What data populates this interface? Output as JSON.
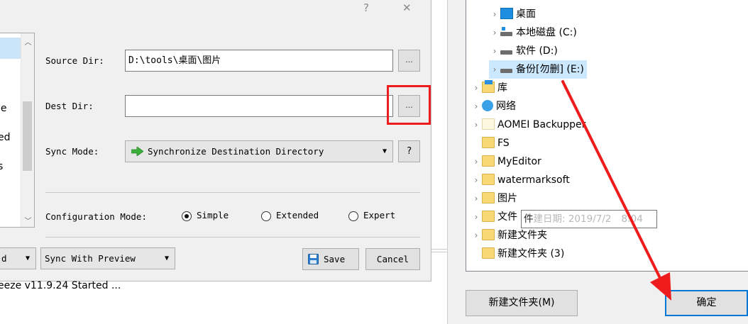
{
  "dialog": {
    "title_buttons": {
      "help": "?",
      "close": "✕"
    },
    "left_list_fragments": [
      "le",
      "ed",
      "s"
    ],
    "source_dir": {
      "label": "Source Dir:",
      "value": "D:\\tools\\桌面\\图片",
      "browse_label": "..."
    },
    "dest_dir": {
      "label": "Dest Dir:",
      "value": "",
      "browse_label": "..."
    },
    "sync_mode": {
      "label": "Sync Mode:",
      "value": "Synchronize Destination Directory",
      "help_label": "?"
    },
    "config_mode": {
      "label": "Configuration Mode:",
      "options": [
        {
          "label": "Simple",
          "selected": true
        },
        {
          "label": "Extended",
          "selected": false
        },
        {
          "label": "Expert",
          "selected": false
        }
      ]
    },
    "bottom": {
      "left_select_fragment": "d",
      "preview_select": "Sync With Preview",
      "save_label": "Save",
      "cancel_label": "Cancel"
    },
    "log_line": "eeze v11.9.24 Started ..."
  },
  "browse": {
    "tree": [
      {
        "label": "桌面",
        "icon": "desktop-icon",
        "indent": 1,
        "expandable": true,
        "selected": false
      },
      {
        "label": "本地磁盘 (C:)",
        "icon": "drive-c-icon",
        "indent": 1,
        "expandable": true,
        "selected": false
      },
      {
        "label": "软件 (D:)",
        "icon": "drive-icon",
        "indent": 1,
        "expandable": true,
        "selected": false
      },
      {
        "label": "备份[勿删] (E:)",
        "icon": "drive-icon",
        "indent": 1,
        "expandable": true,
        "selected": true
      },
      {
        "label": "库",
        "icon": "library-icon",
        "indent": 0,
        "expandable": true,
        "selected": false
      },
      {
        "label": "网络",
        "icon": "network-icon",
        "indent": 0,
        "expandable": true,
        "selected": false
      },
      {
        "label": "AOMEI Backupper",
        "icon": "folder-blank-icon",
        "indent": 0,
        "expandable": true,
        "selected": false
      },
      {
        "label": "FS",
        "icon": "folder-icon",
        "indent": 0,
        "expandable": false,
        "selected": false
      },
      {
        "label": "MyEditor",
        "icon": "folder-icon",
        "indent": 0,
        "expandable": true,
        "selected": false
      },
      {
        "label": "watermarksoft",
        "icon": "folder-icon",
        "indent": 0,
        "expandable": true,
        "selected": false
      },
      {
        "label": "图片",
        "icon": "folder-icon",
        "indent": 0,
        "expandable": true,
        "selected": false
      },
      {
        "label": "文件",
        "icon": "folder-icon",
        "indent": 0,
        "expandable": true,
        "selected": false
      },
      {
        "label": "新建文件夹",
        "icon": "folder-icon",
        "indent": 0,
        "expandable": true,
        "selected": false
      },
      {
        "label": "新建文件夹 (3)",
        "icon": "folder-icon",
        "indent": 0,
        "expandable": false,
        "selected": false
      }
    ],
    "tooltip": {
      "overlap": "件",
      "text": "建日期: 2019/7/2",
      "tail": "8:04"
    },
    "new_folder_label": "新建文件夹(M)",
    "ok_label": "确定"
  },
  "colors": {
    "highlight": "#ee1c1c",
    "selection": "#cce8ff",
    "ok_border": "#0078d7",
    "arrow": "#ee1c1c"
  }
}
